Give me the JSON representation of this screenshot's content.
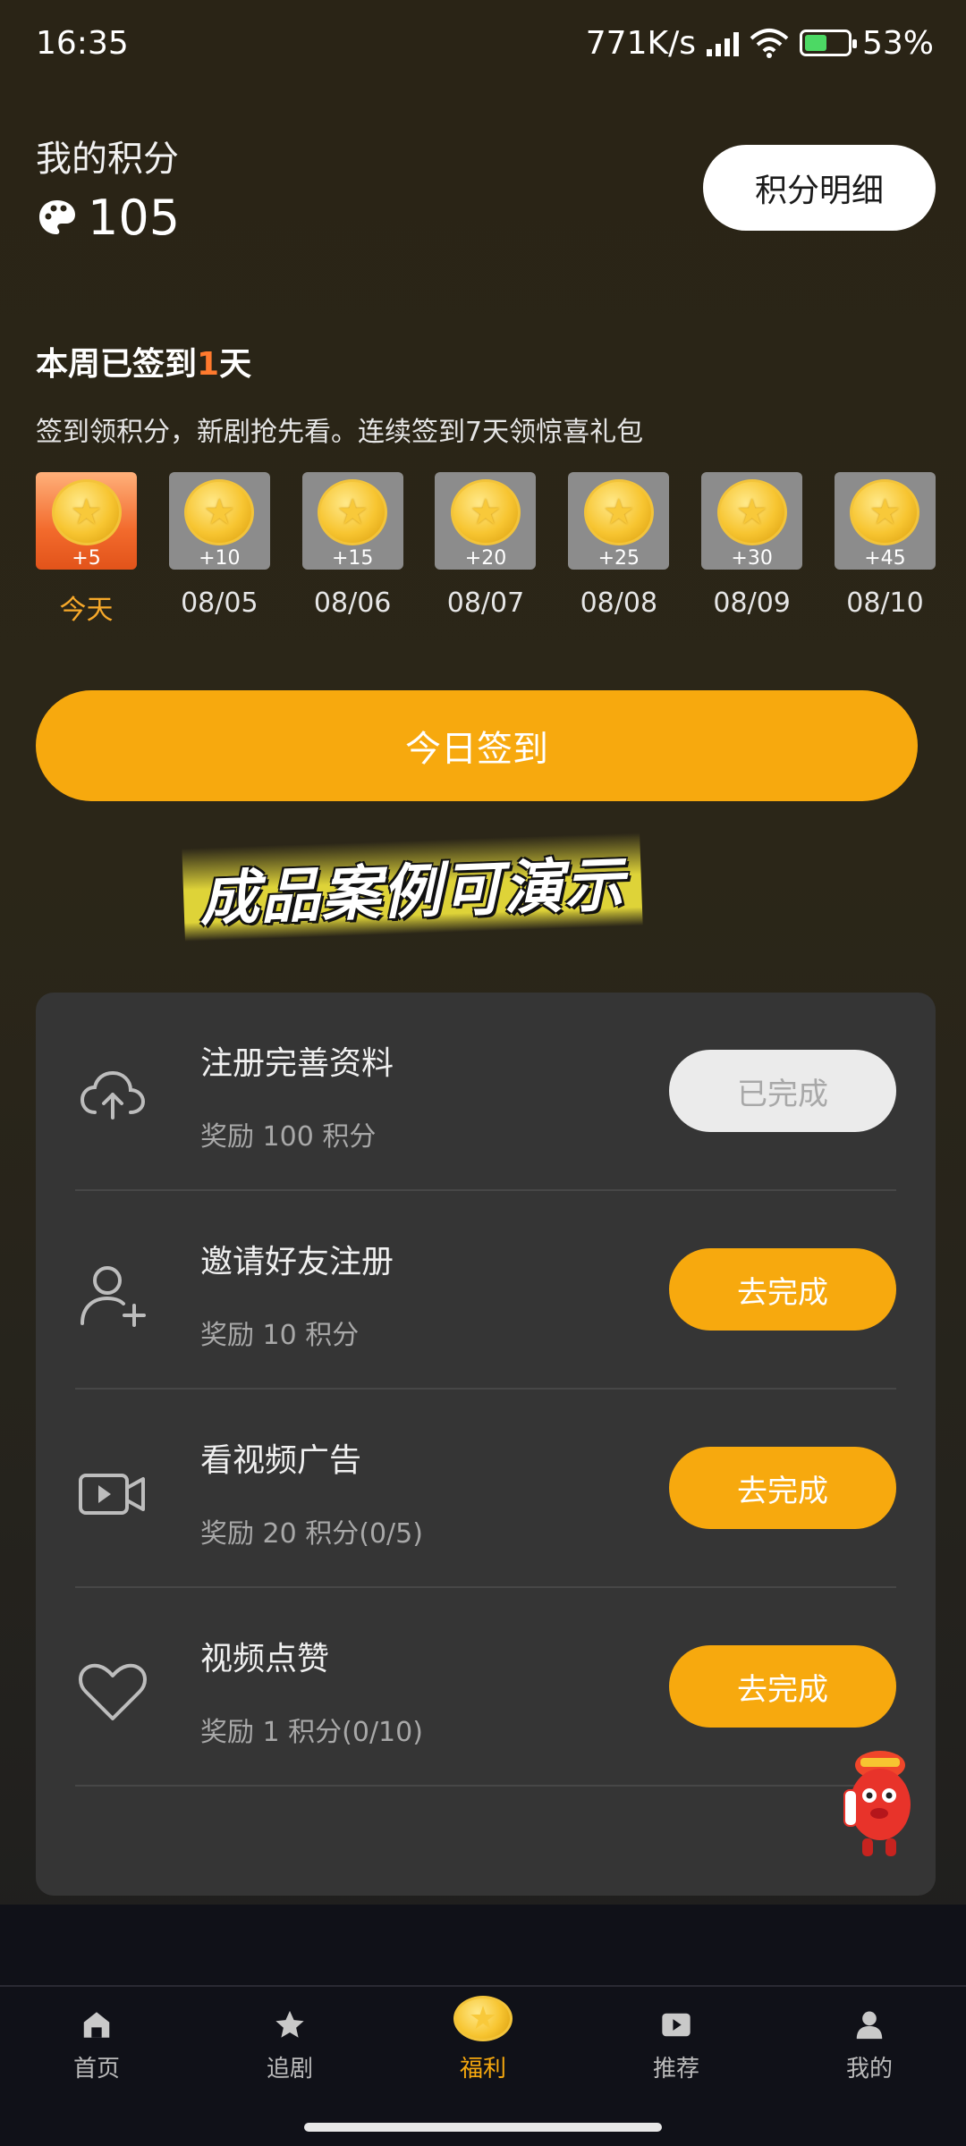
{
  "status_bar": {
    "time": "16:35",
    "net_speed": "771K/s",
    "battery": "53%"
  },
  "points": {
    "label": "我的积分",
    "value": "105",
    "detail_button": "积分明细"
  },
  "checkin": {
    "title_prefix": "本周已签到",
    "days_count": "1",
    "title_suffix": "天",
    "subtitle": "签到领积分，新剧抢先看。连续签到7天领惊喜礼包",
    "days": [
      {
        "reward": "+5",
        "date": "今天",
        "today": true
      },
      {
        "reward": "+10",
        "date": "08/05"
      },
      {
        "reward": "+15",
        "date": "08/06"
      },
      {
        "reward": "+20",
        "date": "08/07"
      },
      {
        "reward": "+25",
        "date": "08/08"
      },
      {
        "reward": "+30",
        "date": "08/09"
      },
      {
        "reward": "+45",
        "date": "08/10"
      }
    ],
    "button": "今日签到"
  },
  "watermark": "成品案例可演示",
  "tasks": [
    {
      "icon": "cloud-upload-icon",
      "title": "注册完善资料",
      "reward": "奖励 100 积分",
      "button": "已完成",
      "done": true
    },
    {
      "icon": "add-user-icon",
      "title": "邀请好友注册",
      "reward": "奖励 10 积分",
      "button": "去完成",
      "done": false
    },
    {
      "icon": "video-icon",
      "title": "看视频广告",
      "reward": "奖励 20 积分(0/5)",
      "button": "去完成",
      "done": false
    },
    {
      "icon": "heart-icon",
      "title": "视频点赞",
      "reward": "奖励 1 积分(0/10)",
      "button": "去完成",
      "done": false
    }
  ],
  "tabbar": [
    {
      "label": "首页",
      "icon": "home-icon"
    },
    {
      "label": "追剧",
      "icon": "star-icon"
    },
    {
      "label": "福利",
      "icon": "coin-icon",
      "active": true
    },
    {
      "label": "推荐",
      "icon": "play-icon"
    },
    {
      "label": "我的",
      "icon": "profile-icon"
    }
  ],
  "colors": {
    "accent": "#f7a90e",
    "today_card": "#f26a2c",
    "highlight": "#ff7a2e",
    "card_bg": "#353535"
  }
}
